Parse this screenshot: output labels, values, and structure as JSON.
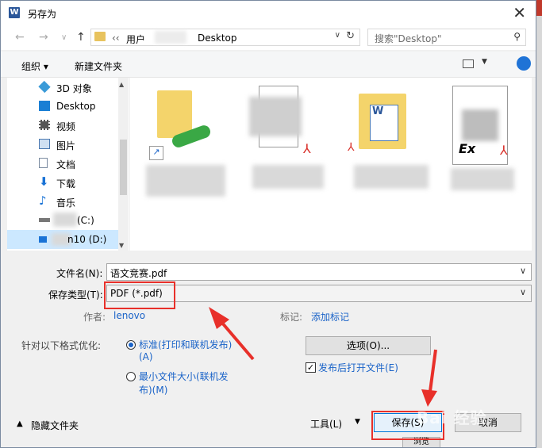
{
  "window": {
    "title": "另存为",
    "app_icon_letter": "W",
    "close_glyph": "✕"
  },
  "navigation": {
    "back_glyph": "←",
    "forward_glyph": "→",
    "history_glyph": "∨",
    "up_glyph": "↑",
    "breadcrumb": [
      "‹‹",
      "用户",
      "Desktop"
    ],
    "refresh_glyph": "↻",
    "search_placeholder": "搜索\"Desktop\"",
    "search_glyph": "⚲"
  },
  "toolbar": {
    "organize_label": "组织 ▾",
    "new_folder_label": "新建文件夹",
    "view_drop_glyph": "▼"
  },
  "sidebar": {
    "items": [
      {
        "label": "3D 对象",
        "icon": "cube-icon",
        "color": "#3b9bd8"
      },
      {
        "label": "Desktop",
        "icon": "desktop-icon",
        "color": "#1a7fd4"
      },
      {
        "label": "视频",
        "icon": "video-icon",
        "color": "#555555"
      },
      {
        "label": "图片",
        "icon": "pictures-icon",
        "color": "#4a78b0"
      },
      {
        "label": "文档",
        "icon": "documents-icon",
        "color": "#7a8aa0"
      },
      {
        "label": "下载",
        "icon": "download-icon",
        "color": "#1a73d6"
      },
      {
        "label": "音乐",
        "icon": "music-icon",
        "color": "#1a73d6"
      },
      {
        "label": "(C:)",
        "icon": "drive-icon",
        "color": "#555555"
      },
      {
        "label": "n10 (D:)",
        "icon": "drive-icon",
        "color": "#555555"
      }
    ],
    "selected_index": 8
  },
  "form": {
    "filename_label": "文件名(N):",
    "filename_value": "语文竞赛.pdf",
    "filetype_label": "保存类型(T):",
    "filetype_value": "PDF (*.pdf)",
    "author_label": "作者:",
    "author_value": "lenovo",
    "tags_label": "标记:",
    "tags_value": "添加标记",
    "optimize_label": "针对以下格式优化:",
    "option_standard": "标准(打印和联机发布)",
    "option_standard_key": "(A)",
    "option_min": "最小文件大小(联机发",
    "option_min_key": "布)(M)",
    "options_button": "选项(O)...",
    "open_after_label": "发布后打开文件(E)",
    "open_after_checked": true,
    "hide_folders": "隐藏文件夹",
    "tools_label": "工具(L)",
    "save_button": "保存(S)",
    "cancel_button": "取消",
    "partial_label": "浏览"
  },
  "watermark": "Bai 经验",
  "colors": {
    "accent": "#1a63c8",
    "annotation": "#e8302a",
    "selection": "#cce8ff"
  }
}
